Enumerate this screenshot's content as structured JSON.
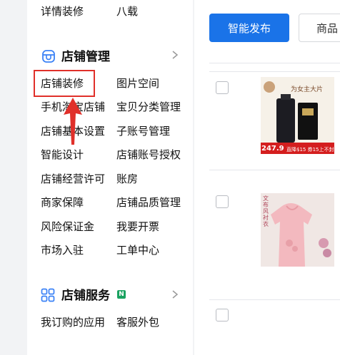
{
  "sidebar": {
    "top_row": [
      "详情装修",
      "八载"
    ],
    "store_management": {
      "title": "店铺管理",
      "items": [
        [
          "店铺装修",
          "图片空间"
        ],
        [
          "手机淘宝店铺",
          "宝贝分类管理"
        ],
        [
          "店铺基本设置",
          "子账号管理"
        ],
        [
          "智能设计",
          "店铺账号授权"
        ],
        [
          "店铺经营许可",
          "账房"
        ],
        [
          "商家保障",
          "店铺品质管理"
        ],
        [
          "风险保证金",
          "我要开票"
        ],
        [
          "市场入驻",
          "工单中心"
        ]
      ]
    },
    "store_services": {
      "title": "店铺服务",
      "badge": "N",
      "items": [
        [
          "我订购的应用",
          "客服外包"
        ]
      ]
    }
  },
  "main": {
    "primary_button": "智能发布",
    "secondary_button": "商品"
  },
  "products": [
    {
      "thumb_text": "为女主大片",
      "price": "247.9",
      "promo": "直降$15 券15上不封"
    },
    {
      "thumb_text": "文布风衬衣"
    }
  ],
  "colors": {
    "primary": "#1a73e8",
    "highlight_box": "#e0302a",
    "arrow": "#e0302a",
    "section_icon": "#3b82f6",
    "badge": "#1aa260"
  }
}
